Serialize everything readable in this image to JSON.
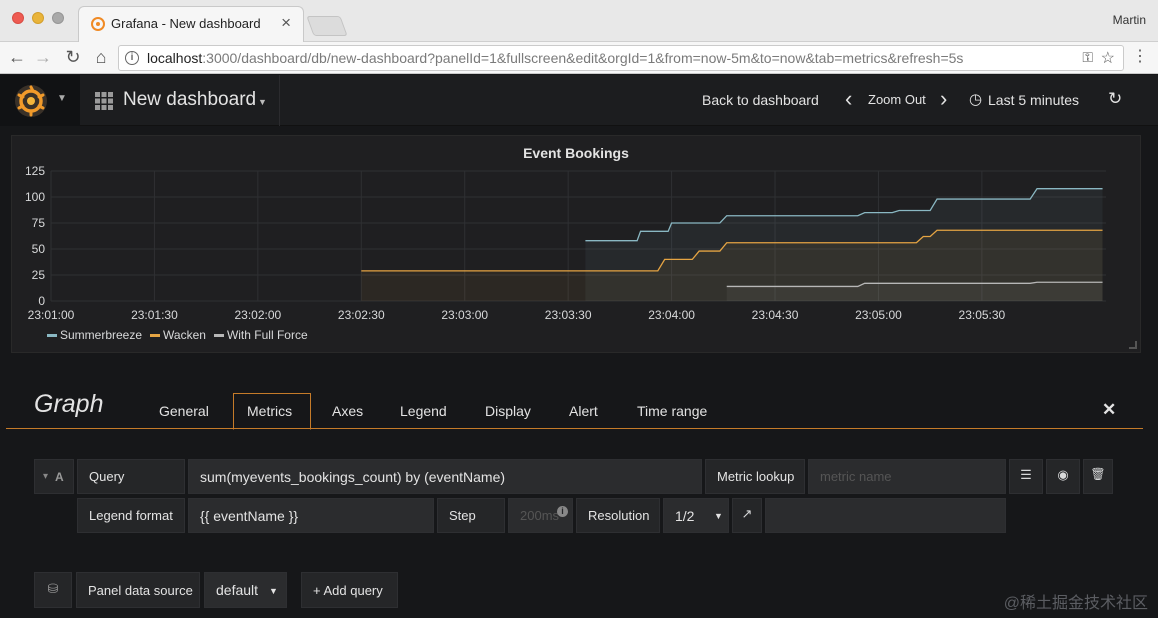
{
  "browser": {
    "tab_title": "Grafana - New dashboard",
    "tab_close": "×",
    "user": "Martin",
    "url_host": "localhost",
    "url_rest": ":3000/dashboard/db/new-dashboard?panelId=1&fullscreen&edit&orgId=1&from=now-5m&to=now&tab=metrics&refresh=5s",
    "back": "←",
    "forward": "→",
    "reload": "↻",
    "home": "⌂",
    "info_glyph": "i",
    "key_glyph": "⚿",
    "star_glyph": "☆",
    "menu_glyph": "⋮"
  },
  "topbar": {
    "dashboard_title": "New dashboard",
    "caret": "▼",
    "back_to_dashboard": "Back to dashboard",
    "zoom_prev": "‹",
    "zoom_out": "Zoom Out",
    "zoom_next": "›",
    "clock_icon": "◷",
    "time_range": "Last 5 minutes",
    "refresh_icon": "↻"
  },
  "panel": {
    "title": "Event Bookings",
    "legend": [
      {
        "name": "Summerbreeze",
        "color": "#8ab8c3"
      },
      {
        "name": "Wacken",
        "color": "#e5a443"
      },
      {
        "name": "With Full Force",
        "color": "#b7b7b7"
      }
    ]
  },
  "chart_data": {
    "type": "line",
    "title": "Event Bookings",
    "xlabel": "",
    "ylabel": "",
    "ylim": [
      0,
      125
    ],
    "xlim": [
      "23:01:00",
      "23:06:06"
    ],
    "yticks": [
      "0",
      "25",
      "50",
      "75",
      "100",
      "125"
    ],
    "xticks": [
      "23:01:00",
      "23:01:30",
      "23:02:00",
      "23:02:30",
      "23:03:00",
      "23:03:30",
      "23:04:00",
      "23:04:30",
      "23:05:00",
      "23:05:30"
    ],
    "grid": true,
    "legend_position": "bottom-left",
    "series": [
      {
        "name": "Summerbreeze",
        "color": "#8ab8c3",
        "points": [
          [
            "23:03:35",
            58
          ],
          [
            "23:03:50",
            58
          ],
          [
            "23:03:51",
            67
          ],
          [
            "23:03:59",
            67
          ],
          [
            "23:04:00",
            75
          ],
          [
            "23:04:14",
            75
          ],
          [
            "23:04:16",
            82
          ],
          [
            "23:04:54",
            82
          ],
          [
            "23:04:56",
            85
          ],
          [
            "23:05:04",
            85
          ],
          [
            "23:05:06",
            87
          ],
          [
            "23:05:15",
            87
          ],
          [
            "23:05:17",
            98
          ],
          [
            "23:05:44",
            98
          ],
          [
            "23:05:46",
            108
          ],
          [
            "23:06:05",
            108
          ]
        ]
      },
      {
        "name": "Wacken",
        "color": "#e5a443",
        "points": [
          [
            "23:02:30",
            29
          ],
          [
            "23:03:35",
            29
          ],
          [
            "23:03:56",
            29
          ],
          [
            "23:03:58",
            40
          ],
          [
            "23:04:06",
            40
          ],
          [
            "23:04:08",
            48
          ],
          [
            "23:04:14",
            48
          ],
          [
            "23:04:16",
            56
          ],
          [
            "23:05:11",
            56
          ],
          [
            "23:05:13",
            62
          ],
          [
            "23:05:15",
            62
          ],
          [
            "23:05:17",
            68
          ],
          [
            "23:06:05",
            68
          ]
        ]
      },
      {
        "name": "With Full Force",
        "color": "#b7b7b7",
        "points": [
          [
            "23:04:16",
            14
          ],
          [
            "23:04:54",
            14
          ],
          [
            "23:04:56",
            17
          ],
          [
            "23:05:44",
            17
          ],
          [
            "23:05:46",
            18
          ],
          [
            "23:06:05",
            18
          ]
        ]
      }
    ]
  },
  "editor": {
    "title": "Graph",
    "tabs": [
      "General",
      "Metrics",
      "Axes",
      "Legend",
      "Display",
      "Alert",
      "Time range"
    ],
    "active_tab": "Metrics",
    "close": "✕",
    "query_row": {
      "collapse_glyph": "▾",
      "ref_id": "A",
      "query_label": "Query",
      "query_value": "sum(myevents_bookings_count) by (eventName)",
      "metric_lookup_label": "Metric lookup",
      "metric_lookup_placeholder": "metric name",
      "menu_glyph": "☰",
      "eye_glyph": "◉",
      "trash_glyph": "🗑"
    },
    "options_row": {
      "legend_format_label": "Legend format",
      "legend_format_value": "{{ eventName }}",
      "step_label": "Step",
      "step_placeholder": "200ms",
      "resolution_label": "Resolution",
      "resolution_value": "1/2",
      "resolution_caret": "▼",
      "link_glyph": "↗"
    },
    "datasource_row": {
      "db_glyph": "⛁",
      "label": "Panel data source",
      "value": "default",
      "caret": "▼",
      "add_query": "+ Add query"
    }
  },
  "watermark": "@稀土掘金技术社区"
}
